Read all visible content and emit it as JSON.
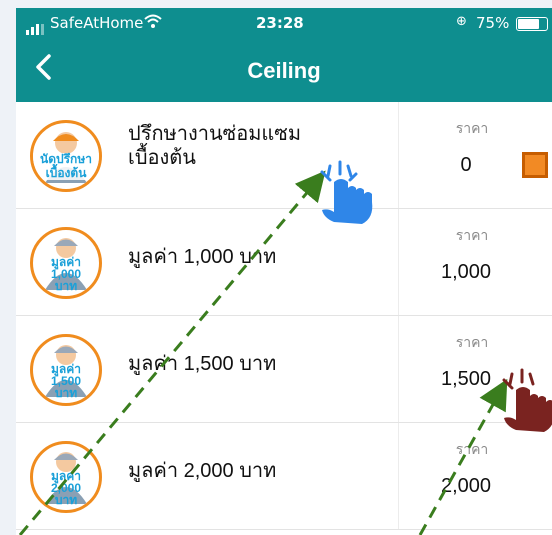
{
  "status_bar": {
    "carrier": "SafeAtHome",
    "time": "23:28",
    "battery": "75%",
    "wifi_icon": "wifi-icon",
    "battery_level": 0.75
  },
  "nav": {
    "title": "Ceiling",
    "back_icon": "chevron-left-icon"
  },
  "items": [
    {
      "name_line1": "ปรึกษางานซ่อมแซม",
      "name_line2": "เบื้องต้น",
      "price_label": "ราคา",
      "price": "0",
      "avatar_lines": [
        "นัดปรึกษา",
        "เบื้องต้น"
      ]
    },
    {
      "name_line1": "มูลค่า 1,000 บาท",
      "name_line2": "",
      "price_label": "ราคา",
      "price": "1,000",
      "avatar_lines": [
        "มูลค่า",
        "1,000",
        "บาท"
      ]
    },
    {
      "name_line1": "มูลค่า 1,500 บาท",
      "name_line2": "",
      "price_label": "ราคา",
      "price": "1,500",
      "avatar_lines": [
        "มูลค่า",
        "1,500",
        "บาท"
      ]
    },
    {
      "name_line1": "มูลค่า 2,000 บาท",
      "name_line2": "",
      "price_label": "ราคา",
      "price": "2,000",
      "avatar_lines": [
        "มูลค่า",
        "2,000",
        "บาท"
      ]
    }
  ],
  "colors": {
    "header": "#0e8e8f",
    "accent": "#f28a24",
    "tap_blue": "#2f86e8",
    "tap_red": "#7a2320",
    "arrow": "#3a7d1e"
  }
}
